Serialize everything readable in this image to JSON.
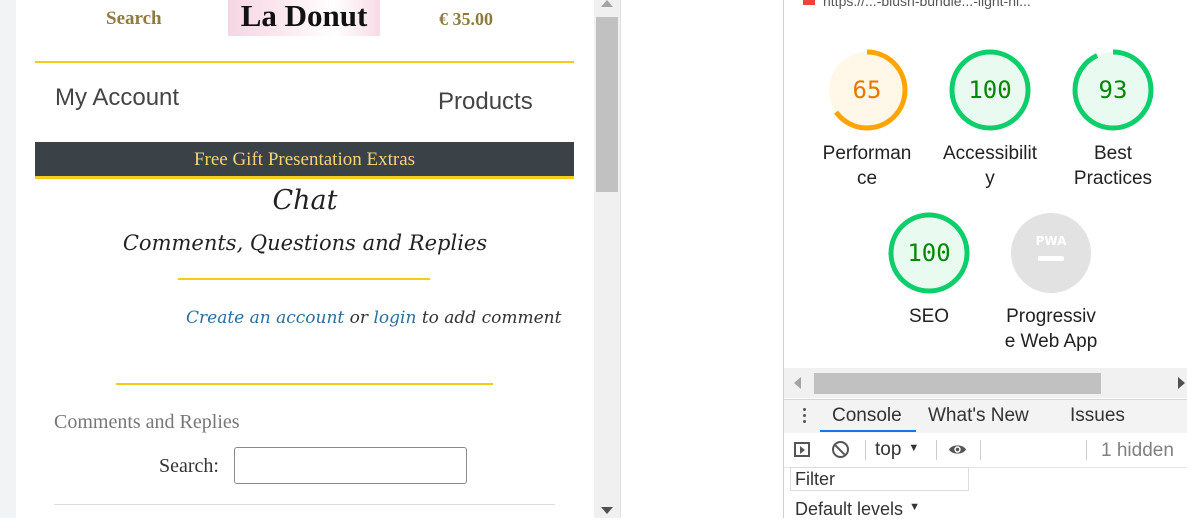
{
  "site": {
    "header": {
      "search_label": "Search",
      "logo_text": "La Donut",
      "price": "€ 35.00"
    },
    "nav": {
      "my_account": "My Account",
      "products": "Products"
    },
    "banner": "Free Gift Presentation Extras",
    "chat": {
      "title": "Chat",
      "subtitle": "Comments, Questions and Replies",
      "create_account_link": "Create an account",
      "or_text": "or",
      "login_link": "login",
      "to_add_text": "to add comment"
    },
    "comments": {
      "title": "Comments and Replies",
      "search_label": "Search:",
      "search_value": ""
    }
  },
  "devtools": {
    "url_fragment": "https://...-blush-bundle...-light-hi...",
    "lighthouse": {
      "gauges": [
        {
          "score": "65",
          "label": "Performance",
          "label_lines": [
            "Performan",
            "ce"
          ],
          "color": "#ffa400",
          "bg": "#fff7e8",
          "fraction": 0.65
        },
        {
          "score": "100",
          "label": "Accessibility",
          "label_lines": [
            "Accessibilit",
            "y"
          ],
          "color": "#0cce6b",
          "bg": "#e9faf0",
          "fraction": 1.0
        },
        {
          "score": "93",
          "label": "Best Practices",
          "label_lines": [
            "Best",
            "Practices"
          ],
          "color": "#0cce6b",
          "bg": "#e9faf0",
          "fraction": 0.93
        },
        {
          "score": "100",
          "label": "SEO",
          "label_lines": [
            "SEO"
          ],
          "color": "#0cce6b",
          "bg": "#e9faf0",
          "fraction": 1.0
        },
        {
          "score": "PWA",
          "label": "Progressive Web App",
          "label_lines": [
            "Progressiv",
            "e Web App"
          ],
          "color": "#cccccc",
          "bg": "#e2e2e2",
          "fraction": 0
        }
      ]
    },
    "drawer": {
      "tabs": [
        "Console",
        "What's New",
        "Issues"
      ],
      "active_tab": "Console"
    },
    "console": {
      "context": "top",
      "hidden_count": "1 hidden",
      "filter_placeholder": "Filter",
      "levels": "Default levels"
    }
  }
}
